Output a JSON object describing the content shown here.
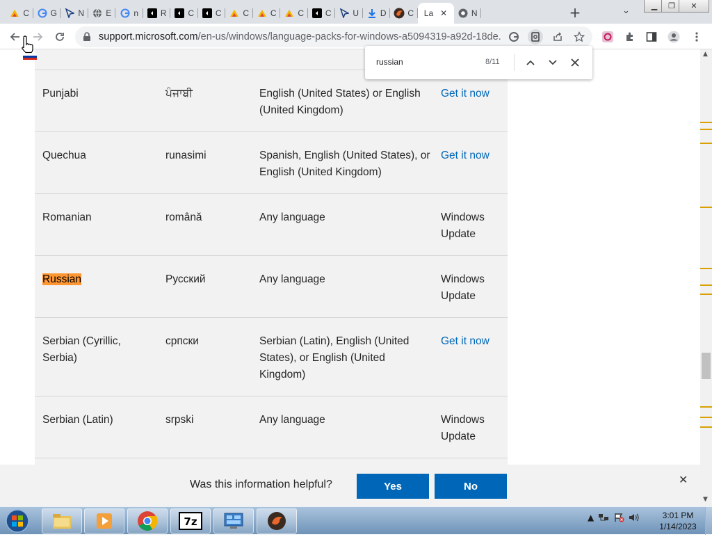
{
  "tabs": [
    {
      "icon": "colorful-logo-icon",
      "label": "C"
    },
    {
      "icon": "google-icon",
      "label": "G"
    },
    {
      "icon": "pointer-logo-icon",
      "label": "N"
    },
    {
      "icon": "globe-icon",
      "label": "E"
    },
    {
      "icon": "google-icon",
      "label": "n"
    },
    {
      "icon": "black-square-icon",
      "label": "R"
    },
    {
      "icon": "black-square-icon",
      "label": "C"
    },
    {
      "icon": "black-square-icon",
      "label": "C"
    },
    {
      "icon": "colorful-logo-icon",
      "label": "C"
    },
    {
      "icon": "colorful-logo-icon",
      "label": "C"
    },
    {
      "icon": "colorful-logo-icon",
      "label": "C"
    },
    {
      "icon": "black-square-icon",
      "label": "C"
    },
    {
      "icon": "pointer-logo-icon",
      "label": "U"
    },
    {
      "icon": "download-icon",
      "label": "D"
    },
    {
      "icon": "dark-circle-icon",
      "label": "C"
    },
    {
      "icon": "none",
      "label": "La",
      "active": true
    },
    {
      "icon": "chrome-icon",
      "label": "N"
    }
  ],
  "address_bar": {
    "host": "support.microsoft.com",
    "path": "/en-us/windows/language-packs-for-windows-a5094319-a92d-18de..."
  },
  "find_bar": {
    "query": "russian",
    "count": "8/11"
  },
  "table": {
    "rows": [
      {
        "language": "Punjabi",
        "native": "ਪੰਜਾਬੀ",
        "base": "English (United States) or English (United Kingdom)",
        "availability": "Get it now",
        "is_link": true
      },
      {
        "language": "Quechua",
        "native": "runasimi",
        "base": "Spanish, English (United States), or English (United Kingdom)",
        "availability": "Get it now",
        "is_link": true
      },
      {
        "language": "Romanian",
        "native": "română",
        "base": "Any language",
        "availability": "Windows Update",
        "is_link": false
      },
      {
        "language": "Russian",
        "native": "Русский",
        "base": "Any language",
        "availability": "Windows Update",
        "is_link": false,
        "highlight": true
      },
      {
        "language": "Serbian (Cyrillic, Serbia)",
        "native": "српски",
        "base": "Serbian (Latin), English (United States), or English (United Kingdom)",
        "availability": "Get it now",
        "is_link": true
      },
      {
        "language": "Serbian (Latin)",
        "native": "srpski",
        "base": "Any language",
        "availability": "Windows Update",
        "is_link": false
      }
    ]
  },
  "feedback": {
    "question": "Was this information helpful?",
    "yes": "Yes",
    "no": "No"
  },
  "clock": {
    "time": "3:01 PM",
    "date": "1/14/2023"
  },
  "colors": {
    "link": "#0067b8",
    "find_highlight": "#ff9632",
    "button_blue": "#0067b8"
  }
}
